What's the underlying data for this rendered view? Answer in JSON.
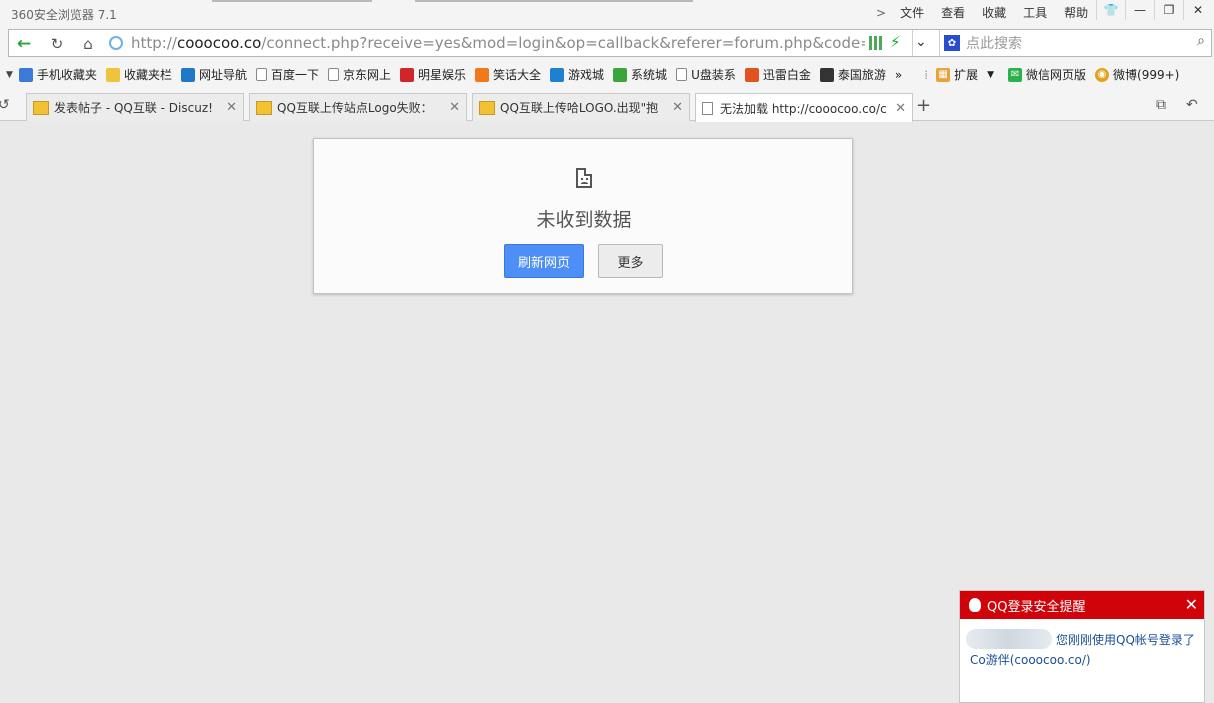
{
  "window": {
    "app_title": "360安全浏览器 7.1",
    "menu": [
      "文件",
      "查看",
      "收藏",
      "工具",
      "帮助"
    ],
    "buttons": {
      "skin": "👕",
      "minimize": "—",
      "restore": "❐",
      "close": "✕"
    }
  },
  "address": {
    "url_prefix": "http://",
    "url_domain": "cooocoo.co",
    "url_rest": "/connect.php?receive=yes&mod=login&op=callback&referer=forum.php&code=",
    "search_placeholder": "点此搜索"
  },
  "bookmarks": [
    {
      "label": "手机收藏夹",
      "icon": "phone-icon",
      "color": "#3b7ad9"
    },
    {
      "label": "收藏夹栏",
      "icon": "folder-icon",
      "color": "#f0c33c"
    },
    {
      "label": "网址导航",
      "icon": "navigation-icon",
      "color": "#1f78c8"
    },
    {
      "label": "百度一下",
      "icon": "page-icon",
      "color": "#ffffff"
    },
    {
      "label": "京东网上",
      "icon": "page-icon",
      "color": "#ffffff"
    },
    {
      "label": "明星娱乐",
      "icon": "entertainment-icon",
      "color": "#d0262a"
    },
    {
      "label": "笑话大全",
      "icon": "fruit-icon",
      "color": "#f07a1a"
    },
    {
      "label": "游戏城",
      "icon": "game-city-icon",
      "color": "#1f7fd0"
    },
    {
      "label": "系统城",
      "icon": "system-city-icon",
      "color": "#3aa53a"
    },
    {
      "label": "U盘装系",
      "icon": "page-icon",
      "color": "#ffffff"
    },
    {
      "label": "迅雷白金",
      "icon": "thunder-icon",
      "color": "#e0531f"
    },
    {
      "label": "泰国旅游",
      "icon": "tripadvisor-icon",
      "color": "#333333"
    }
  ],
  "bookmarks_more": "»",
  "extensions": {
    "apps_label": "扩展",
    "wechat_label": "微信网页版",
    "weibo_label": "微博(999+)"
  },
  "tabs": [
    {
      "title": "发表帖子 - QQ互联 - Discuz!",
      "active": false
    },
    {
      "title": "QQ互联上传站点Logo失败：",
      "active": false
    },
    {
      "title": "QQ互联上传哈LOGO.出现\"抱",
      "active": false
    },
    {
      "title": "无法加载 http://cooocoo.co/c",
      "active": true
    }
  ],
  "error_page": {
    "title": "未收到数据",
    "reload_button": "刷新网页",
    "more_button": "更多"
  },
  "qq_notification": {
    "header": "QQ登录安全提醒",
    "message_line1": "您刚刚使用QQ帐号登录了",
    "message_line2": "Co游伴(cooocoo.co/)"
  }
}
